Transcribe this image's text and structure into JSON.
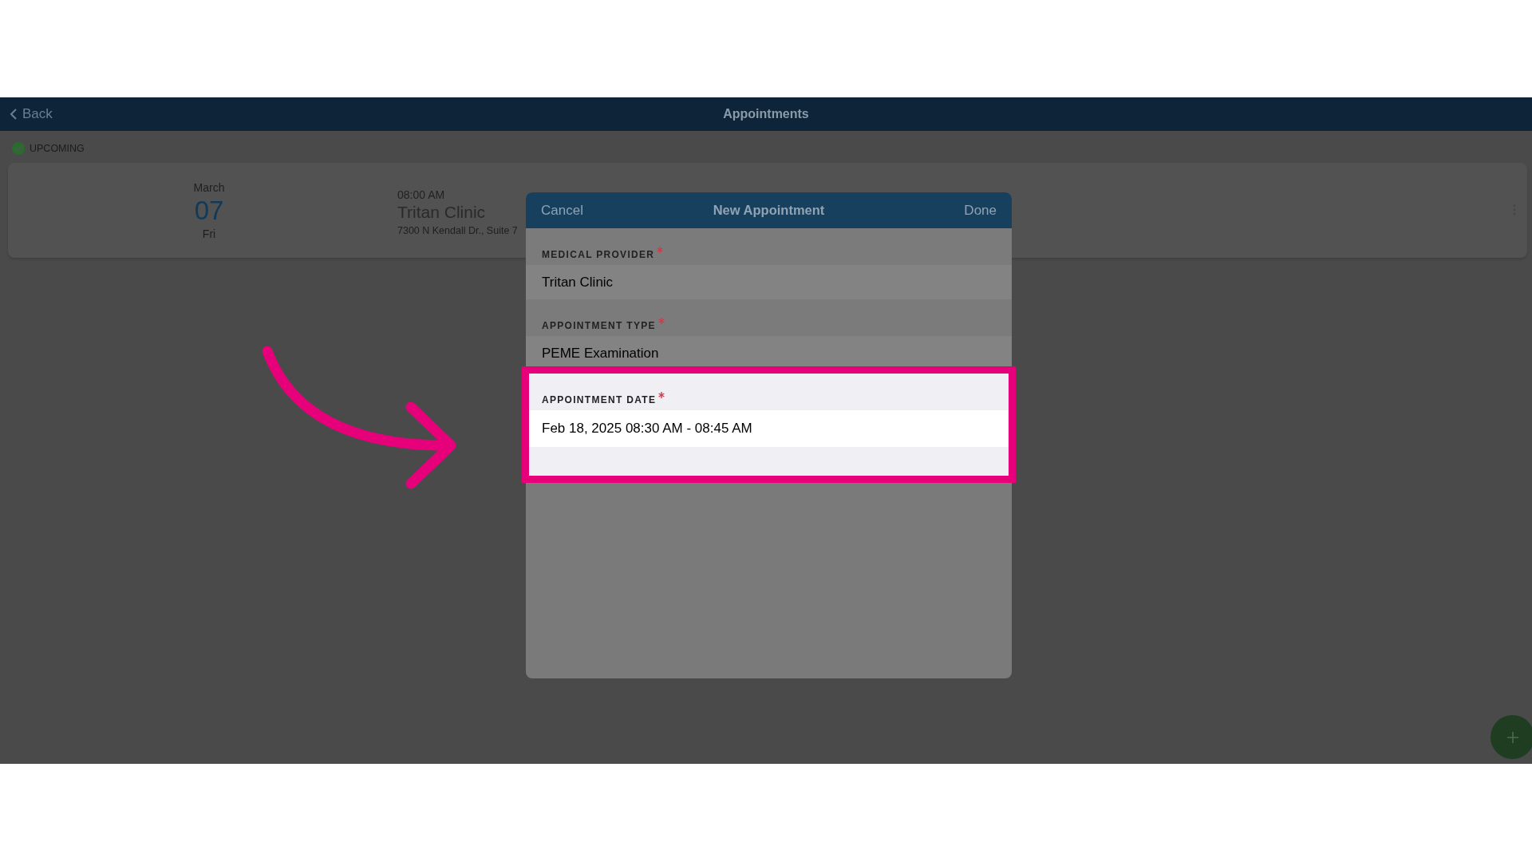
{
  "nav": {
    "back": "Back",
    "title": "Appointments"
  },
  "section": {
    "label": "UPCOMING"
  },
  "appointments": [
    {
      "month": "March",
      "day": "07",
      "weekday": "Fri",
      "time": "08:00 AM",
      "provider": "Tritan Clinic",
      "address": "7300 N Kendall Dr., Suite 7"
    }
  ],
  "dialog": {
    "cancel": "Cancel",
    "title": "New Appointment",
    "done": "Done",
    "fields": [
      {
        "label": "MEDICAL PROVIDER",
        "required": true,
        "value": "Tritan Clinic",
        "highlighted": false
      },
      {
        "label": "APPOINTMENT TYPE",
        "required": true,
        "value": "PEME Examination",
        "highlighted": false
      },
      {
        "label": "APPOINTMENT DATE",
        "required": true,
        "value": "Feb 18, 2025 08:30 AM - 08:45 AM",
        "highlighted": true
      }
    ]
  }
}
